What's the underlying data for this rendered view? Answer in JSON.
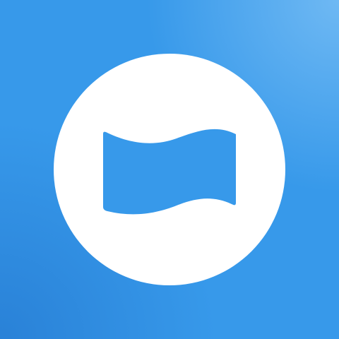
{
  "icon": {
    "name": "flag-logo",
    "shape": "circle-with-waving-flag"
  },
  "colors": {
    "background": "#3799ea",
    "background_highlight": "#6ab4f0",
    "background_shadow": "#2a7fd0",
    "disc": "#ffffff",
    "flag": "#3799ea"
  }
}
